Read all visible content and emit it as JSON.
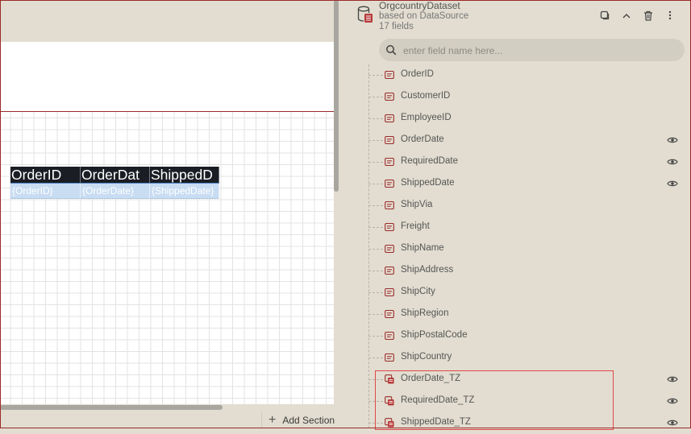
{
  "dataset": {
    "name": "OrgcountryDataset",
    "source": "based on DataSource",
    "field_count": "17 fields"
  },
  "search": {
    "placeholder": "enter field name here..."
  },
  "fields": [
    {
      "name": "OrderID",
      "type": "field",
      "eye": false
    },
    {
      "name": "CustomerID",
      "type": "field",
      "eye": false
    },
    {
      "name": "EmployeeID",
      "type": "field",
      "eye": false
    },
    {
      "name": "OrderDate",
      "type": "field",
      "eye": true
    },
    {
      "name": "RequiredDate",
      "type": "field",
      "eye": true
    },
    {
      "name": "ShippedDate",
      "type": "field",
      "eye": true
    },
    {
      "name": "ShipVia",
      "type": "field",
      "eye": false
    },
    {
      "name": "Freight",
      "type": "field",
      "eye": false
    },
    {
      "name": "ShipName",
      "type": "field",
      "eye": false
    },
    {
      "name": "ShipAddress",
      "type": "field",
      "eye": false
    },
    {
      "name": "ShipCity",
      "type": "field",
      "eye": false
    },
    {
      "name": "ShipRegion",
      "type": "field",
      "eye": false
    },
    {
      "name": "ShipPostalCode",
      "type": "field",
      "eye": false
    },
    {
      "name": "ShipCountry",
      "type": "field",
      "eye": false
    },
    {
      "name": "OrderDate_TZ",
      "type": "calculated",
      "eye": true
    },
    {
      "name": "RequiredDate_TZ",
      "type": "calculated",
      "eye": true
    },
    {
      "name": "ShippedDate_TZ",
      "type": "calculated",
      "eye": true
    }
  ],
  "report_table": {
    "headers": [
      "OrderID",
      "OrderDat",
      "ShippedD"
    ],
    "cells": [
      "{OrderID}",
      "{OrderDate}",
      "{ShippedDate}"
    ]
  },
  "add_section_label": "Add Section",
  "colors": {
    "panel_bg": "#e2ddd0",
    "accent": "#9b2a2a",
    "highlight": "#e04848",
    "table_header": "#1a1d24",
    "table_cell": "#c8dcf2"
  }
}
